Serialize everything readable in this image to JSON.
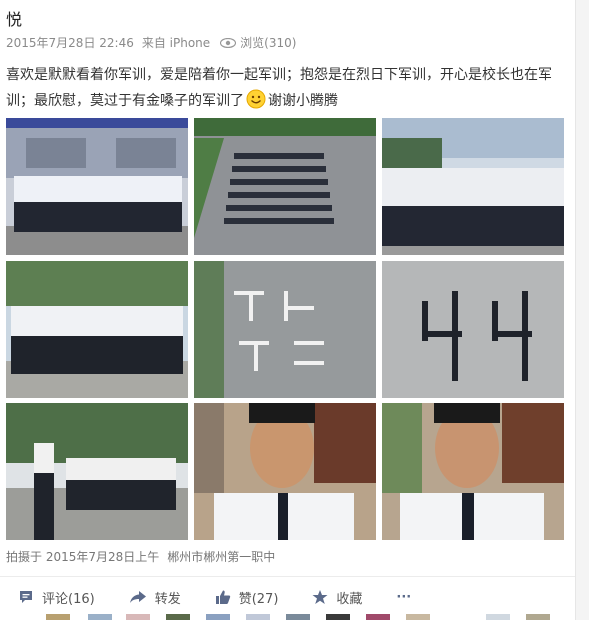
{
  "post": {
    "title": "悦",
    "timestamp": "2015年7月28日 22:46",
    "source": "来自 iPhone",
    "views": "浏览(310)",
    "text_part1": "喜欢是默默看着你军训，爱是陪着你一起军训；抱怨是在烈日下军训，开心是校长也在军训；最欣慰，莫过于有金嗓子的军训了",
    "text_part2": "谢谢小腾腾",
    "photos": [
      {
        "icon": "students-lineup-photo"
      },
      {
        "icon": "aerial-formation-photo"
      },
      {
        "icon": "students-row-photo"
      },
      {
        "icon": "students-standing-photo"
      },
      {
        "icon": "chalk-text-formation-photo"
      },
      {
        "icon": "number-formation-photo"
      },
      {
        "icon": "training-yard-photo"
      },
      {
        "icon": "selfie-photo-1"
      },
      {
        "icon": "selfie-photo-2"
      }
    ],
    "location_label": "拍摄于 2015年7月28日上午",
    "location_place": "郴州市郴州第一职中"
  },
  "actions": {
    "comment": "评论(16)",
    "repost": "转发",
    "like": "赞(27)",
    "favorite": "收藏",
    "more": "···"
  },
  "colors": {
    "meta": "#8a8a8a",
    "text": "#333333",
    "icon": "#5b6a8a"
  }
}
